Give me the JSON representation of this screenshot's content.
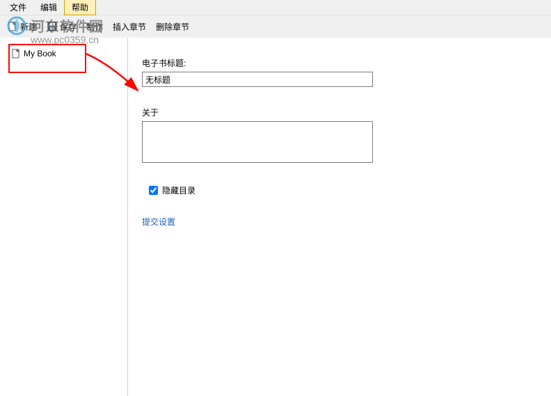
{
  "menubar": {
    "file": "文件",
    "edit": "编辑",
    "help": "帮助"
  },
  "toolbar": {
    "new_label": "新建",
    "save_label": "保存",
    "make_label": "制作",
    "insert_chapter_label": "插入章节",
    "delete_chapter_label": "删除章节"
  },
  "sidebar": {
    "items": [
      {
        "label": "My Book"
      }
    ]
  },
  "form": {
    "title_label": "电子书标题:",
    "title_value": "无标题",
    "about_label": "关于",
    "about_value": "",
    "hide_toc_label": "隐藏目录",
    "hide_toc_checked": true,
    "submit_label": "提交设置"
  },
  "watermark": {
    "brand": "河东软件园",
    "url": "www.pc0359.cn"
  }
}
